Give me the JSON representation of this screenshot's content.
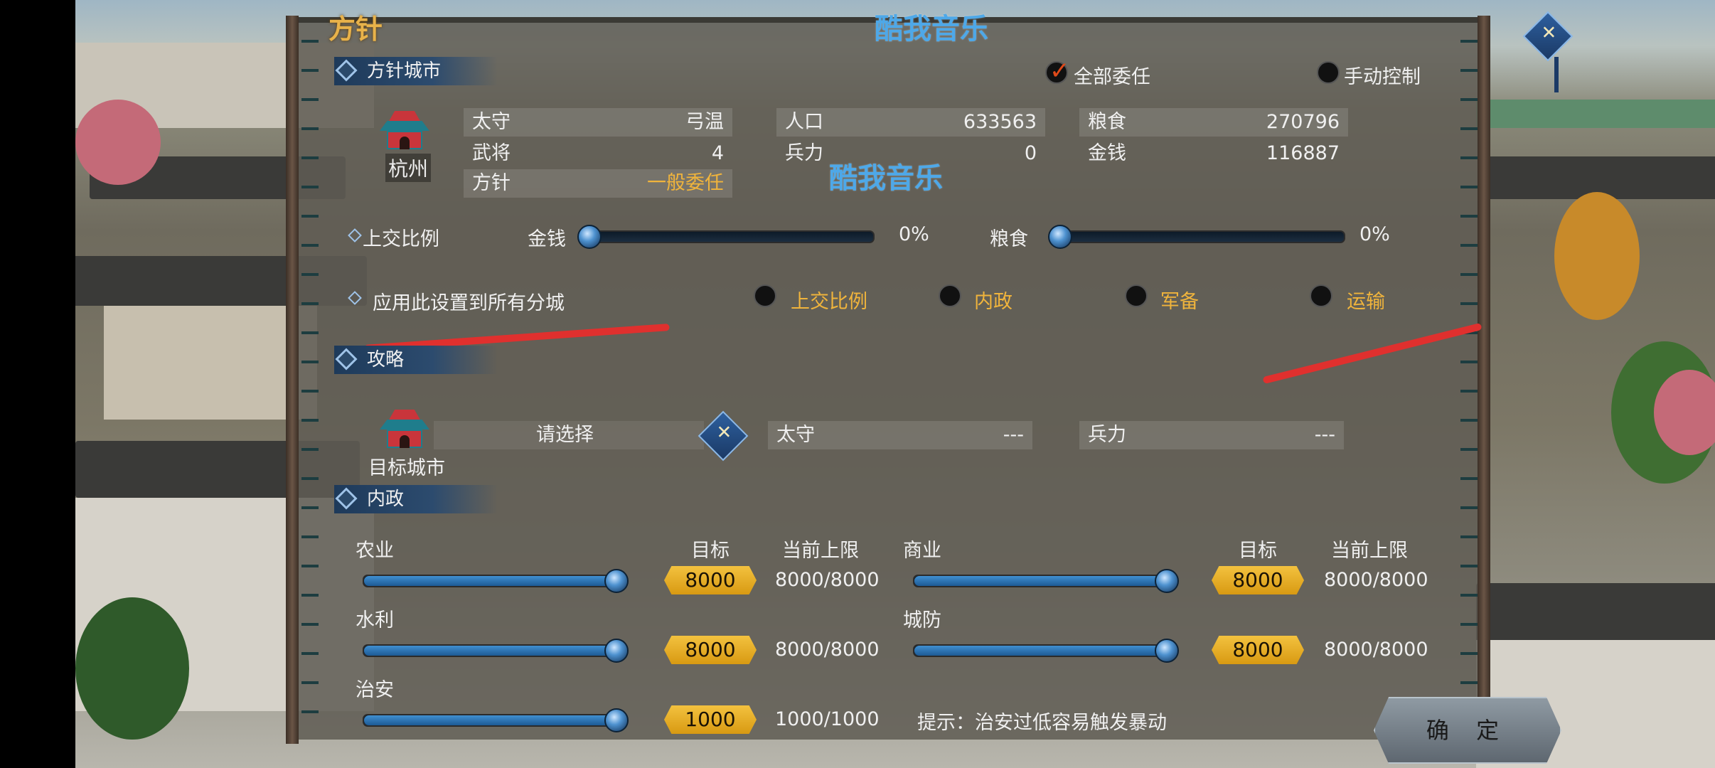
{
  "header": {
    "title": "方针",
    "watermark_top": "酷我音乐",
    "watermark_mid": "酷我音乐"
  },
  "sections": {
    "policy_city": "方针城市",
    "strategy": "攻略",
    "domestic": "内政"
  },
  "control": {
    "delegate_all": "全部委任",
    "manual": "手动控制"
  },
  "city": {
    "name": "杭州",
    "governor_label": "太守",
    "governor_value": "弓温",
    "generals_label": "武将",
    "generals_value": "4",
    "policy_label": "方针",
    "policy_value": "一般委任",
    "population_label": "人口",
    "population_value": "633563",
    "troops_label": "兵力",
    "troops_value": "0",
    "food_label": "粮食",
    "food_value": "270796",
    "money_label": "金钱",
    "money_value": "116887"
  },
  "tribute": {
    "label": "上交比例",
    "money_label": "金钱",
    "money_percent": "0%",
    "money_level": 0,
    "food_label": "粮食",
    "food_percent": "0%",
    "food_level": 0
  },
  "apply_all": {
    "label": "应用此设置到所有分城",
    "options": [
      "上交比例",
      "内政",
      "军备",
      "运输"
    ]
  },
  "attack": {
    "target_label": "目标城市",
    "select_placeholder": "请选择",
    "governor_label": "太守",
    "governor_value": "---",
    "troops_label": "兵力",
    "troops_value": "---"
  },
  "domestic": {
    "target_header": "目标",
    "limit_header": "当前上限",
    "agriculture": {
      "label": "农业",
      "target": "8000",
      "limit": "8000/8000",
      "level": 1.0
    },
    "commerce": {
      "label": "商业",
      "target": "8000",
      "limit": "8000/8000",
      "level": 1.0
    },
    "irrigation": {
      "label": "水利",
      "target": "8000",
      "limit": "8000/8000",
      "level": 1.0
    },
    "defense": {
      "label": "城防",
      "target": "8000",
      "limit": "8000/8000",
      "level": 1.0
    },
    "security": {
      "label": "治安",
      "target": "1000",
      "limit": "1000/1000",
      "level": 1.0
    },
    "hint": "提示：治安过低容易触发暴动"
  },
  "confirm_label": "确 定",
  "colors": {
    "gold": "#f0b43c",
    "slider_blue": "#3f8fd0",
    "section_blue": "#2c4b6e",
    "annotation_red": "#e0302e"
  }
}
